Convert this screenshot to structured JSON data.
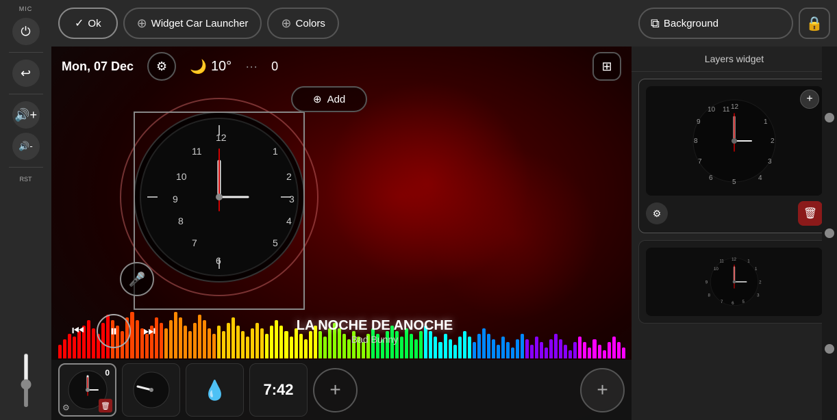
{
  "header": {
    "ok_label": "Ok",
    "widget_label": "Widget Car Launcher",
    "colors_label": "Colors",
    "background_label": "Background"
  },
  "sidebar": {
    "mic_label": "MIC",
    "rst_label": "RST"
  },
  "info_bar": {
    "date": "Mon, 07 Dec",
    "temperature": "10°",
    "signal": "0",
    "add_label": "Add"
  },
  "music": {
    "title": "LA NOCHE DE ANOCHE",
    "artist": "Bad Bunny"
  },
  "time_widget": {
    "time": "7:42"
  },
  "right_panel": {
    "layers_label": "Layers widget"
  },
  "equalizer": {
    "bars": [
      3,
      5,
      7,
      6,
      8,
      10,
      12,
      9,
      7,
      11,
      14,
      12,
      10,
      8,
      13,
      15,
      12,
      9,
      7,
      10,
      13,
      11,
      9,
      12,
      15,
      13,
      10,
      8,
      11,
      14,
      12,
      9,
      7,
      10,
      8,
      11,
      13,
      10,
      8,
      6,
      9,
      11,
      9,
      7,
      10,
      12,
      10,
      8,
      6,
      9,
      7,
      5,
      8,
      10,
      8,
      6,
      9,
      11,
      9,
      7,
      5,
      8,
      6,
      4,
      7,
      9,
      7,
      5,
      8,
      10,
      8,
      6,
      9,
      7,
      5,
      8,
      10,
      8,
      6,
      4,
      7,
      5,
      3,
      6,
      8,
      6,
      4,
      7,
      9,
      7,
      5,
      3,
      6,
      4,
      2,
      5,
      7,
      5,
      3,
      6,
      4,
      2,
      5,
      7,
      5,
      3,
      1,
      4,
      6,
      4,
      2,
      5,
      3,
      1,
      4,
      6,
      4,
      2
    ],
    "colors": [
      "#ff0000",
      "#ff4400",
      "#ff8800",
      "#ffcc00",
      "#ffff00",
      "#88ff00",
      "#00ff44",
      "#00ffff",
      "#0088ff",
      "#8800ff",
      "#ff00ff"
    ]
  }
}
